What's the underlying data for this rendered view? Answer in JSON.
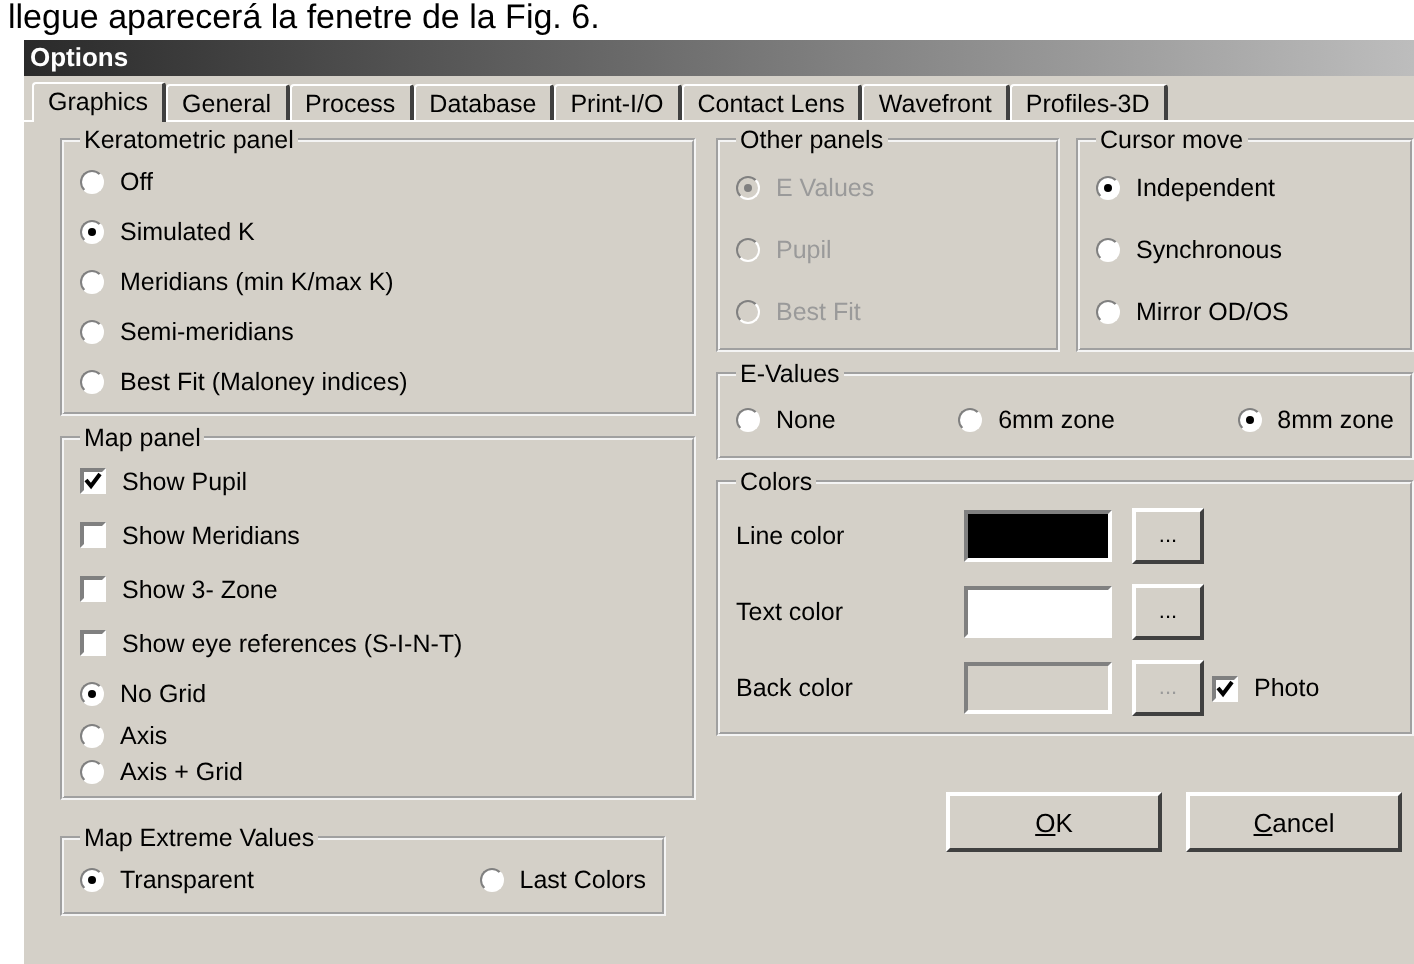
{
  "caption": "llegue aparecerá la fenetre de la Fig. 6.",
  "window": {
    "title": "Options"
  },
  "tabs": [
    {
      "label": "Graphics",
      "selected": true
    },
    {
      "label": "General",
      "selected": false
    },
    {
      "label": "Process",
      "selected": false
    },
    {
      "label": "Database",
      "selected": false
    },
    {
      "label": "Print-I/O",
      "selected": false
    },
    {
      "label": "Contact Lens",
      "selected": false
    },
    {
      "label": "Wavefront",
      "selected": false
    },
    {
      "label": "Profiles-3D",
      "selected": false
    }
  ],
  "keratometric_panel": {
    "title": "Keratometric panel",
    "options": [
      {
        "label": "Off",
        "selected": false
      },
      {
        "label": "Simulated K",
        "selected": true
      },
      {
        "label": "Meridians (min K/max K)",
        "selected": false
      },
      {
        "label": "Semi-meridians",
        "selected": false
      },
      {
        "label": "Best Fit (Maloney indices)",
        "selected": false
      }
    ]
  },
  "map_panel": {
    "title": "Map panel",
    "checkboxes": [
      {
        "label": "Show Pupil",
        "checked": true
      },
      {
        "label": "Show Meridians",
        "checked": false
      },
      {
        "label": "Show 3- Zone",
        "checked": false
      },
      {
        "label": "Show eye references (S-I-N-T)",
        "checked": false
      }
    ],
    "grid_options": [
      {
        "label": "No Grid",
        "selected": true
      },
      {
        "label": "Axis",
        "selected": false
      },
      {
        "label": "Axis + Grid",
        "selected": false
      }
    ]
  },
  "map_extreme_values": {
    "title": "Map Extreme Values",
    "options": [
      {
        "label": "Transparent",
        "selected": true
      },
      {
        "label": "Last Colors",
        "selected": false
      }
    ]
  },
  "other_panels": {
    "title": "Other panels",
    "disabled": true,
    "options": [
      {
        "label": "E Values",
        "selected": true
      },
      {
        "label": "Pupil",
        "selected": false
      },
      {
        "label": "Best Fit",
        "selected": false
      }
    ]
  },
  "cursor_move": {
    "title": "Cursor move",
    "options": [
      {
        "label": "Independent",
        "selected": true
      },
      {
        "label": "Synchronous",
        "selected": false
      },
      {
        "label": "Mirror OD/OS",
        "selected": false
      }
    ]
  },
  "e_values": {
    "title": "E-Values",
    "options": [
      {
        "label": "None",
        "selected": false
      },
      {
        "label": "6mm zone",
        "selected": false
      },
      {
        "label": "8mm zone",
        "selected": true
      }
    ]
  },
  "colors": {
    "title": "Colors",
    "rows": [
      {
        "label": "Line color",
        "color": "#000000",
        "button": "...",
        "disabled": false
      },
      {
        "label": "Text color",
        "color": "#ffffff",
        "button": "...",
        "disabled": false
      },
      {
        "label": "Back color",
        "color": "#d4d0c8",
        "button": "...",
        "disabled": true,
        "photo": {
          "label": "Photo",
          "checked": true
        }
      }
    ]
  },
  "buttons": [
    {
      "underlined": "O",
      "rest": "K"
    },
    {
      "underlined": "C",
      "rest": "ancel"
    }
  ]
}
